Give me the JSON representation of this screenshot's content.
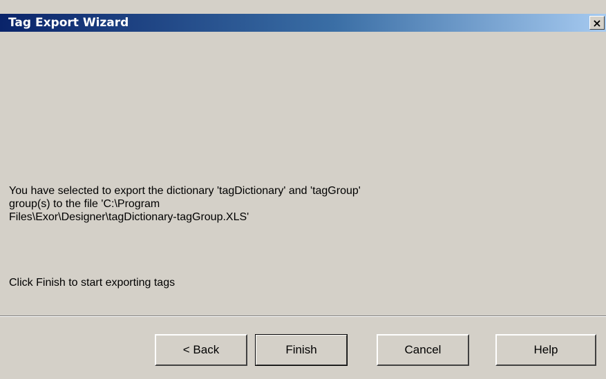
{
  "window": {
    "title": "Tag Export Wizard",
    "close_glyph": "×",
    "close_icon": "close-icon"
  },
  "content": {
    "message_line1": "You have selected to export the dictionary 'tagDictionary' and 'tagGroup'",
    "message_line2": "group(s) to the file 'C:\\Program",
    "message_line3": "Files\\Exor\\Designer\\tagDictionary-tagGroup.XLS'",
    "hint": "Click Finish to start exporting tags"
  },
  "buttons": {
    "back": "< Back",
    "finish": "Finish",
    "cancel": "Cancel",
    "help": "Help"
  },
  "colors": {
    "titlebar_start": "#0a246a",
    "titlebar_end": "#a6caf0",
    "dialog_bg": "#d4d0c8"
  }
}
